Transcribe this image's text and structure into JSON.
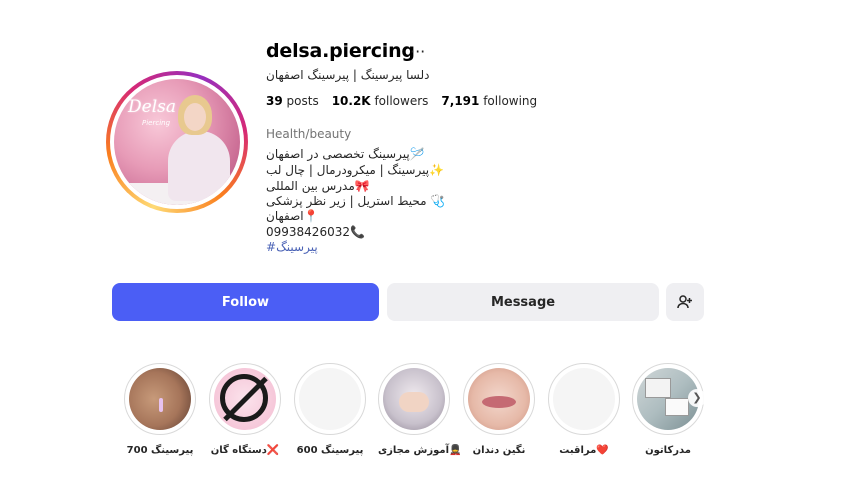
{
  "profile": {
    "username": "delsa.piercing",
    "full_name": "دلسا پیرسینگ | پیرسینگ اصفهان",
    "avatar_logo": "Delsa",
    "avatar_logo_sub": "Piercing",
    "stats": {
      "posts_count": "39",
      "posts_label": "posts",
      "followers_count": "10.2K",
      "followers_label": "followers",
      "following_count": "7,191",
      "following_label": "following"
    },
    "category": "Health/beauty",
    "bio": [
      "پیرسینگ تخصصی در اصفهان🪡",
      "پیرسینگ | میکرودرمال | چال لب✨",
      "مدرس بین المللی🎀",
      "محیط استریل | زیر نظر پزشکی 🩺",
      "اصفهان📍",
      "09938426032📞"
    ],
    "hashtag": "#پیرسینگ"
  },
  "actions": {
    "follow_label": "Follow",
    "message_label": "Message",
    "suggest_icon": "person-plus-icon"
  },
  "highlights": [
    {
      "label": "پیرسینگ 700"
    },
    {
      "label": "دستگاه گان❌"
    },
    {
      "label": "پیرسینگ 600"
    },
    {
      "label": "آموزش مجازی💂"
    },
    {
      "label": "نگین دندان"
    },
    {
      "label": "مراقبت❤️"
    },
    {
      "label": "مدرکاتون"
    }
  ],
  "colors": {
    "follow_button": "#4b5ef5",
    "secondary_button": "#efeff2",
    "hashtag": "#4b63b6"
  }
}
